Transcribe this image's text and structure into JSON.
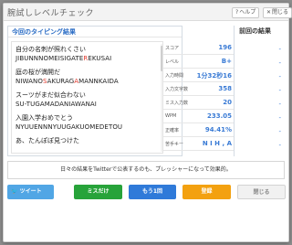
{
  "window": {
    "title": "腕試しレベルチェック",
    "help_label": "ヘルプ",
    "close_label": "閉じる"
  },
  "typing": {
    "section_title": "今回のタイピング結果",
    "lines": [
      {
        "jp": "自分の名刺が照れくさい",
        "romaji_parts": [
          {
            "t": "JIBUNNNOMEISIGATE",
            "e": false
          },
          {
            "t": "R",
            "e": true
          },
          {
            "t": "EKUSAI",
            "e": false
          }
        ]
      },
      {
        "jp": "庭の桜が満開だ",
        "romaji_parts": [
          {
            "t": "NIWANO",
            "e": false
          },
          {
            "t": "S",
            "e": true
          },
          {
            "t": "AKURAG",
            "e": false
          },
          {
            "t": "A",
            "e": true
          },
          {
            "t": "MANNKAIDA",
            "e": false
          }
        ]
      },
      {
        "jp": "スーツがまだ似合わない",
        "romaji_parts": [
          {
            "t": "SU-TUGAMADANIAWANAI",
            "e": false
          }
        ]
      },
      {
        "jp": "入園入学おめでとう",
        "romaji_parts": [
          {
            "t": "NYUUENNNYUUGAKUOMEDETOU",
            "e": false
          }
        ]
      },
      {
        "jp": "あ、たんぽぽ見つけた",
        "romaji_parts": []
      }
    ]
  },
  "stats": {
    "items": [
      {
        "label": "スコア",
        "value": "196"
      },
      {
        "label": "レベル",
        "value": "B+"
      },
      {
        "label": "入力時間",
        "value": "1分32秒16"
      },
      {
        "label": "入力文字数",
        "value": "358"
      },
      {
        "label": "ミス入力数",
        "value": "20"
      },
      {
        "label": "WPM",
        "value": "233.05"
      },
      {
        "label": "正確率",
        "value": "94.41%"
      },
      {
        "label": "苦手キー",
        "value": "N I H , A"
      }
    ]
  },
  "previous": {
    "title": "前回の結果",
    "values": [
      "-",
      "-",
      "-",
      "-",
      "-",
      "-",
      "-",
      "-"
    ]
  },
  "message": "日々の結果をTwitterで公表するのも、プレッシャーになって効果的。",
  "buttons": {
    "tweet": "ツイート",
    "mistake": "ミスだけ",
    "retry": "もう1回",
    "register": "登録",
    "close": "閉じる"
  }
}
